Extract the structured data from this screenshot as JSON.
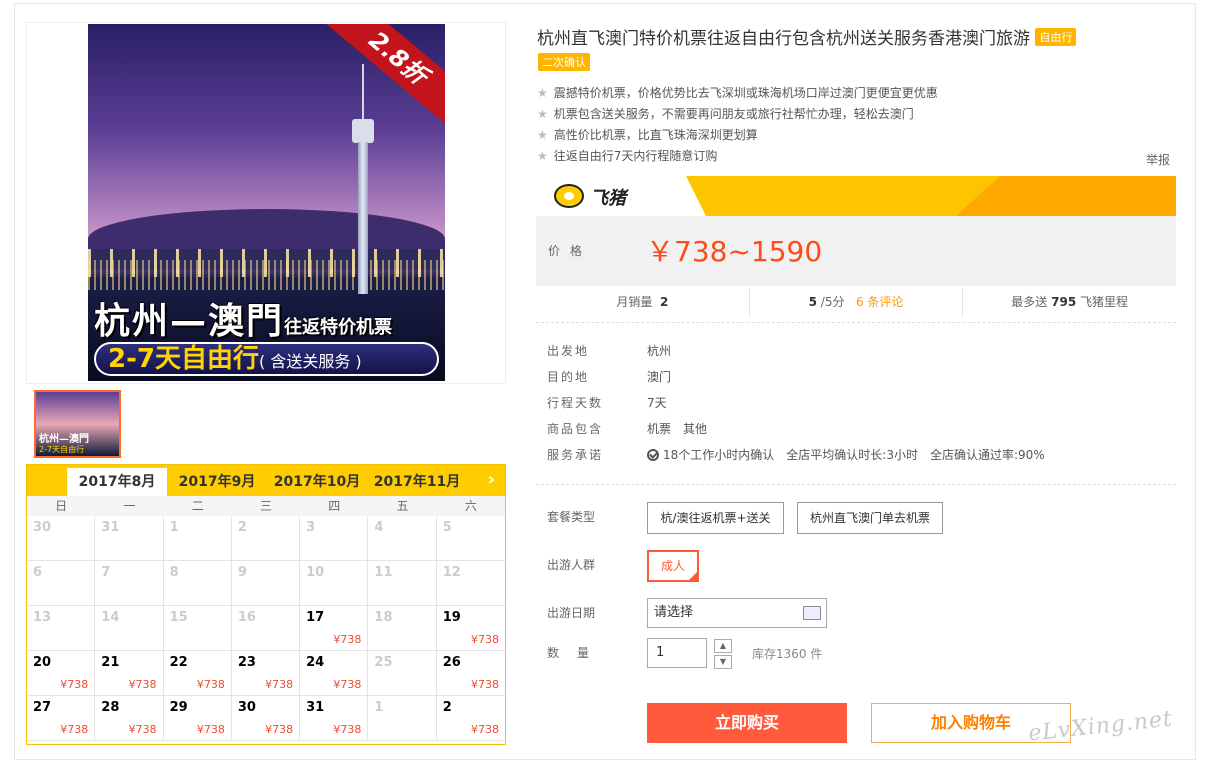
{
  "product": {
    "title": "杭州直飞澳门特价机票往返自由行包含杭州送关服务香港澳门旅游",
    "tag": "自由行",
    "tag2": "二次确认",
    "features": [
      "震撼特价机票，价格优势比去飞深圳或珠海机场口岸过澳门更便宜更优惠",
      "机票包含送关服务，不需要再问朋友或旅行社帮忙办理，轻松去澳门",
      "高性价比机票，比直飞珠海深圳更划算",
      "往返自由行7天内行程随意订购"
    ],
    "report": "举报"
  },
  "poster": {
    "discount": "2.8折",
    "route": "杭州—澳門",
    "route_sub": "往返特价机票",
    "days": "2-7天自由行",
    "days_sub": "( 含送关服务 )"
  },
  "price": {
    "brand": "飞猪",
    "label": "价格",
    "value": "￥738~1590"
  },
  "stats": {
    "sales_label": "月销量",
    "sales": "2",
    "rating": "5",
    "rating_suffix": "/5分",
    "reviews": "6 条评论",
    "miles_prefix": "最多送",
    "miles": "795",
    "miles_suffix": "飞猪里程"
  },
  "attrs": [
    {
      "k": "出发地",
      "v": "杭州"
    },
    {
      "k": "目的地",
      "v": "澳门"
    },
    {
      "k": "行程天数",
      "v": "7天"
    },
    {
      "k": "商品包含",
      "v": [
        "机票",
        "其他"
      ]
    },
    {
      "k": "服务承诺",
      "v": [
        "18个工作小时内确认",
        "全店平均确认时长:3小时",
        "全店确认通过率:90%"
      ]
    }
  ],
  "options": {
    "package_label": "套餐类型",
    "packages": [
      "杭/澳往返机票+送关",
      "杭州直飞澳门单去机票"
    ],
    "people_label": "出游人群",
    "people": "成人",
    "date_label": "出游日期",
    "date_value": "请选择",
    "qty_label": "数量",
    "qty_value": "1",
    "stock": "库存1360 件",
    "up": "▲",
    "down": "▼"
  },
  "actions": {
    "buy": "立即购买",
    "cart": "加入购物车"
  },
  "watermark": "eLvXing.net",
  "calendar": {
    "months": [
      "2017年8月",
      "2017年9月",
      "2017年10月",
      "2017年11月"
    ],
    "next": "›",
    "weekdays": [
      "日",
      "一",
      "二",
      "三",
      "四",
      "五",
      "六"
    ],
    "days": [
      {
        "d": "30",
        "p": ""
      },
      {
        "d": "31",
        "p": ""
      },
      {
        "d": "1",
        "p": ""
      },
      {
        "d": "2",
        "p": ""
      },
      {
        "d": "3",
        "p": ""
      },
      {
        "d": "4",
        "p": ""
      },
      {
        "d": "5",
        "p": ""
      },
      {
        "d": "6",
        "p": ""
      },
      {
        "d": "7",
        "p": ""
      },
      {
        "d": "8",
        "p": ""
      },
      {
        "d": "9",
        "p": ""
      },
      {
        "d": "10",
        "p": ""
      },
      {
        "d": "11",
        "p": ""
      },
      {
        "d": "12",
        "p": ""
      },
      {
        "d": "13",
        "p": ""
      },
      {
        "d": "14",
        "p": ""
      },
      {
        "d": "15",
        "p": ""
      },
      {
        "d": "16",
        "p": ""
      },
      {
        "d": "17",
        "p": "¥738"
      },
      {
        "d": "18",
        "p": ""
      },
      {
        "d": "19",
        "p": "¥738"
      },
      {
        "d": "20",
        "p": "¥738"
      },
      {
        "d": "21",
        "p": "¥738"
      },
      {
        "d": "22",
        "p": "¥738"
      },
      {
        "d": "23",
        "p": "¥738"
      },
      {
        "d": "24",
        "p": "¥738"
      },
      {
        "d": "25",
        "p": ""
      },
      {
        "d": "26",
        "p": "¥738"
      },
      {
        "d": "27",
        "p": "¥738"
      },
      {
        "d": "28",
        "p": "¥738"
      },
      {
        "d": "29",
        "p": "¥738"
      },
      {
        "d": "30",
        "p": "¥738"
      },
      {
        "d": "31",
        "p": "¥738"
      },
      {
        "d": "1",
        "p": ""
      },
      {
        "d": "2",
        "p": "¥738"
      }
    ]
  }
}
